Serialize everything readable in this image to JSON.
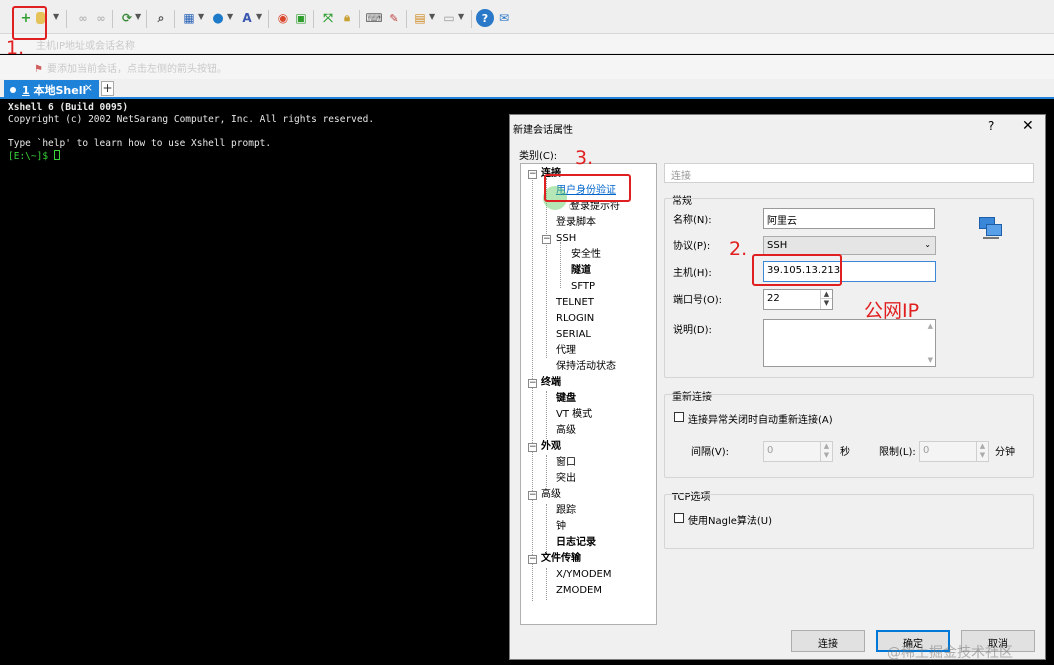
{
  "app": {
    "address_placeholder": "主机IP地址或会话名称",
    "hint": "要添加当前会话，点击左侧的箭头按钮。",
    "tab_number": "1",
    "tab_label": "本地Shell",
    "tab_close": "×",
    "tab_add": "+"
  },
  "terminal": {
    "line1": "Xshell 6 (Build 0095)",
    "line2": "Copyright (c) 2002 NetSarang Computer, Inc. All rights reserved.",
    "line3": "Type `help' to learn how to use Xshell prompt.",
    "prompt": "[E:\\~]$ "
  },
  "dialog": {
    "title": "新建会话属性",
    "help": "?",
    "close": "✕",
    "category_label": "类别(C):",
    "tree": [
      {
        "label": "连接"
      },
      {
        "label": "用户身份验证"
      },
      {
        "label": "登录提示符"
      },
      {
        "label": "登录脚本"
      },
      {
        "label": "SSH"
      },
      {
        "label": "安全性"
      },
      {
        "label": "隧道"
      },
      {
        "label": "SFTP"
      },
      {
        "label": "TELNET"
      },
      {
        "label": "RLOGIN"
      },
      {
        "label": "SERIAL"
      },
      {
        "label": "代理"
      },
      {
        "label": "保持活动状态"
      },
      {
        "label": "终端"
      },
      {
        "label": "键盘"
      },
      {
        "label": "VT 模式"
      },
      {
        "label": "高级"
      },
      {
        "label": "外观"
      },
      {
        "label": "窗口"
      },
      {
        "label": "突出"
      },
      {
        "label": "高级"
      },
      {
        "label": "跟踪"
      },
      {
        "label": "钟"
      },
      {
        "label": "日志记录"
      },
      {
        "label": "文件传输"
      },
      {
        "label": "X/YMODEM"
      },
      {
        "label": "ZMODEM"
      }
    ],
    "panel_title": "连接",
    "general": {
      "title": "常规",
      "name_label": "名称(N):",
      "name_value": "阿里云",
      "protocol_label": "协议(P):",
      "protocol_value": "SSH",
      "host_label": "主机(H):",
      "host_value": "39.105.13.213",
      "port_label": "端口号(O):",
      "port_value": "22",
      "desc_label": "说明(D):",
      "desc_value": ""
    },
    "reconnect": {
      "title": "重新连接",
      "auto_label": "连接异常关闭时自动重新连接(A)",
      "interval_label": "间隔(V):",
      "interval_value": "0",
      "interval_unit": "秒",
      "limit_label": "限制(L):",
      "limit_value": "0",
      "limit_unit": "分钟"
    },
    "tcp": {
      "title": "TCP选项",
      "nagle_label": "使用Nagle算法(U)"
    },
    "buttons": {
      "connect": "连接",
      "ok": "确定",
      "cancel": "取消"
    }
  },
  "annotations": {
    "step1": "1.",
    "step2": "2.",
    "step3": "3.",
    "public_ip": "公网IP"
  },
  "watermark": "@稀土掘金技术社区"
}
